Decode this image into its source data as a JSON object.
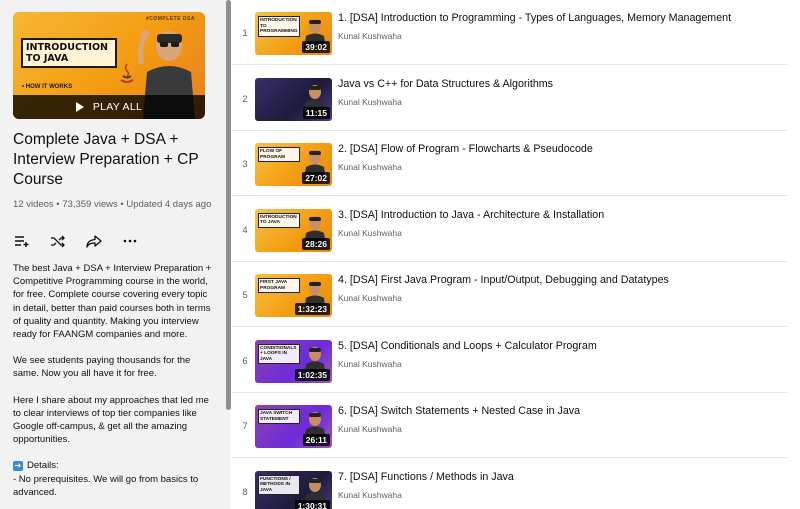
{
  "playlist": {
    "hero_tag": "#COMPLETE DSA",
    "hero_title_line1": "INTRODUCTION",
    "hero_title_line2": "TO JAVA",
    "hero_bullet": "• HOW IT WORKS",
    "play_all_label": "PLAY ALL",
    "title": "Complete Java + DSA + Interview Preparation + CP Course",
    "meta": "12 videos • 73,359 views • Updated 4 days ago",
    "actions": [
      {
        "icon": "add-to-queue-icon"
      },
      {
        "icon": "shuffle-icon"
      },
      {
        "icon": "share-icon"
      },
      {
        "icon": "more-icon"
      }
    ],
    "description": {
      "p1": "The best Java + DSA + Interview Preparation + Competitive Programming course in the world, for free. Complete course covering every topic in detail, better than paid courses both in terms of quality and quantity. Making you interview ready for FAANGM companies and more.",
      "p2": "We see students paying thousands for the same. Now you all have it for free.",
      "p3": "Here I share about my approaches that led me to clear interviews of top tier companies like Google off-campus, & get all the amazing opportunities.",
      "details_label": "Details:",
      "details_line1": "- No prerequisites. We will go from basics to",
      "details_line2": "advanced."
    }
  },
  "videos": [
    {
      "index": "1",
      "title": "1. [DSA] Introduction to Programming - Types of Languages, Memory Management",
      "channel": "Kunal Kushwaha",
      "duration": "39:02",
      "thumb_text": "INTRODUCTION TO PROGRAMMING",
      "theme": "orange"
    },
    {
      "index": "2",
      "title": "Java vs C++ for Data Structures & Algorithms",
      "channel": "Kunal Kushwaha",
      "duration": "11:15",
      "thumb_text": "",
      "theme": "dark"
    },
    {
      "index": "3",
      "title": "2. [DSA] Flow of Program - Flowcharts & Pseudocode",
      "channel": "Kunal Kushwaha",
      "duration": "27:02",
      "thumb_text": "FLOW OF PROGRAM",
      "theme": "orange"
    },
    {
      "index": "4",
      "title": "3. [DSA] Introduction to Java - Architecture & Installation",
      "channel": "Kunal Kushwaha",
      "duration": "28:26",
      "thumb_text": "INTRODUCTION TO JAVA",
      "theme": "orange"
    },
    {
      "index": "5",
      "title": "4. [DSA] First Java Program - Input/Output, Debugging and Datatypes",
      "channel": "Kunal Kushwaha",
      "duration": "1:32:23",
      "thumb_text": "FIRST JAVA PROGRAM",
      "theme": "orange"
    },
    {
      "index": "6",
      "title": "5. [DSA] Conditionals and Loops + Calculator Program",
      "channel": "Kunal Kushwaha",
      "duration": "1:02:35",
      "thumb_text": "CONDITIONALS + LOOPS IN JAVA",
      "theme": "purple"
    },
    {
      "index": "7",
      "title": "6. [DSA] Switch Statements + Nested Case in Java",
      "channel": "Kunal Kushwaha",
      "duration": "26:11",
      "thumb_text": "JAVA SWITCH STATEMENT",
      "theme": "purple"
    },
    {
      "index": "8",
      "title": "7. [DSA] Functions / Methods in Java",
      "channel": "Kunal Kushwaha",
      "duration": "1:30:31",
      "thumb_text": "FUNCTIONS / METHODS IN JAVA",
      "theme": "dark"
    }
  ]
}
